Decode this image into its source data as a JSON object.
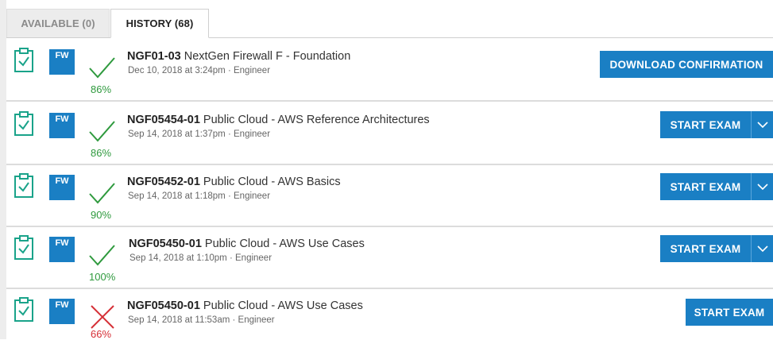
{
  "tabs": [
    {
      "label": "AVAILABLE (0)",
      "active": false
    },
    {
      "label": "HISTORY (68)",
      "active": true
    }
  ],
  "colors": {
    "accent": "#1a7fc4",
    "pass": "#2f9a3e",
    "fail": "#d52f36",
    "clipboard": "#1aa38a"
  },
  "history": [
    {
      "badge": "FW",
      "status": "pass",
      "status_icon": "check-icon",
      "score": "86%",
      "code": "NGF01-03",
      "name": "NextGen Firewall F - Foundation",
      "date": "Dec 10, 2018 at 3:24pm",
      "role": "Engineer",
      "action": "DOWNLOAD CONFIRMATION"
    },
    {
      "badge": "FW",
      "status": "pass",
      "status_icon": "check-icon",
      "score": "86%",
      "code": "NGF05454-01",
      "name": "Public Cloud - AWS Reference Architectures",
      "date": "Sep 14, 2018 at 1:37pm",
      "role": "Engineer",
      "action": "START EXAM"
    },
    {
      "badge": "FW",
      "status": "pass",
      "status_icon": "check-icon",
      "score": "90%",
      "code": "NGF05452-01",
      "name": "Public Cloud - AWS Basics",
      "date": "Sep 14, 2018 at 1:18pm",
      "role": "Engineer",
      "action": "START EXAM"
    },
    {
      "badge": "FW",
      "status": "pass",
      "status_icon": "check-icon",
      "score": "100%",
      "code": "NGF05450-01",
      "name": "Public Cloud - AWS Use Cases",
      "date": "Sep 14, 2018 at 1:10pm",
      "role": "Engineer",
      "action": "START EXAM"
    },
    {
      "badge": "FW",
      "status": "fail",
      "status_icon": "cross-icon",
      "score": "66%",
      "code": "NGF05450-01",
      "name": "Public Cloud - AWS Use Cases",
      "date": "Sep 14, 2018 at 11:53am",
      "role": "Engineer",
      "action": "START EXAM"
    }
  ]
}
